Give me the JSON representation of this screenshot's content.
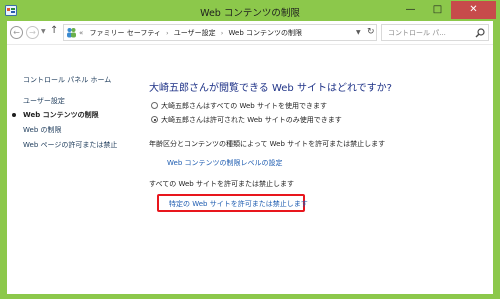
{
  "window": {
    "title": "Web コンテンツの制限",
    "min_glyph": "—",
    "max_glyph": "□",
    "close_glyph": "✕"
  },
  "nav": {
    "back_glyph": "←",
    "forward_glyph": "→",
    "up_glyph": "↑"
  },
  "address": {
    "overflow": "«",
    "crumbs": [
      "ファミリー セーフティ",
      "ユーザー設定",
      "Web コンテンツの制限"
    ],
    "refresh_glyph": "↻"
  },
  "search": {
    "placeholder": "コントロール パ..."
  },
  "sidebar": {
    "home": "コントロール パネル ホーム",
    "items": [
      {
        "label": "ユーザー設定",
        "current": false
      },
      {
        "label": "Web コンテンツの制限",
        "current": true
      },
      {
        "label": "Web の制限",
        "current": false
      },
      {
        "label": "Web ページの許可または禁止",
        "current": false
      }
    ]
  },
  "main": {
    "heading": "大崎五郎さんが閲覧できる Web サイトはどれですか?",
    "options": [
      {
        "label": "大崎五郎さんはすべての Web サイトを使用できます",
        "selected": false
      },
      {
        "label": "大崎五郎さんは許可された Web サイトのみ使用できます",
        "selected": true
      }
    ],
    "rating_text": "年齢区分とコンテンツの種類によって Web サイトを許可または禁止します",
    "rating_link": "Web コンテンツの制限レベルの設定",
    "all_sites_text": "すべての Web サイトを許可または禁止します",
    "specific_link": "特定の Web サイトを許可または禁止します"
  },
  "colors": {
    "titlebar": "#8cc84b",
    "close": "#c74b4b",
    "heading": "#1e3287",
    "link": "#1c5bb0",
    "highlight": "#e8161d"
  },
  "icons": {
    "app": "control-panel-icon",
    "address": "family-safety-icon",
    "search": "search-icon"
  }
}
